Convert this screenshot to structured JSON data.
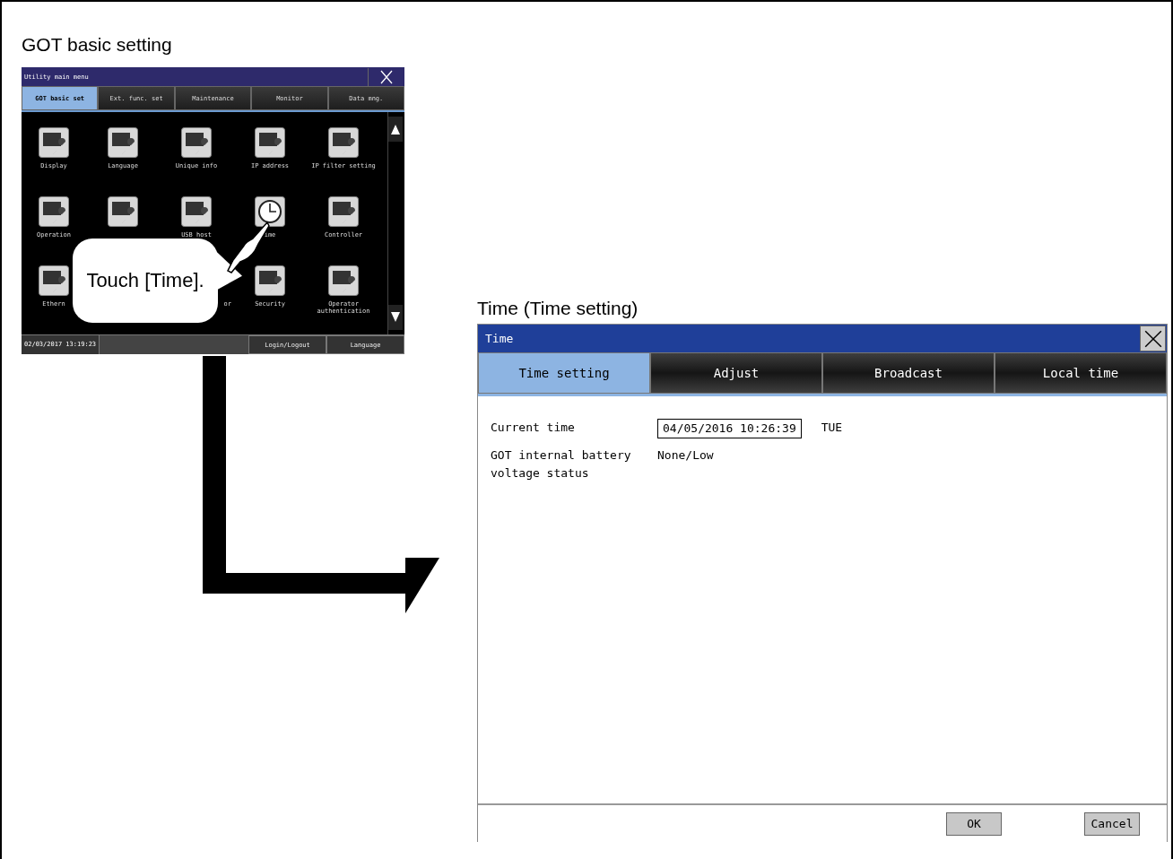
{
  "section_title": "GOT basic setting",
  "utility_menu": {
    "title": "Utility main menu",
    "tabs": [
      {
        "label": "GOT basic set",
        "selected": true
      },
      {
        "label": "Ext. func. set",
        "selected": false
      },
      {
        "label": "Maintenance",
        "selected": false
      },
      {
        "label": "Monitor",
        "selected": false
      },
      {
        "label": "Data mng.",
        "selected": false
      }
    ],
    "items": [
      {
        "kind": "tile",
        "label": "Display"
      },
      {
        "kind": "tile",
        "label": "Language"
      },
      {
        "kind": "tile",
        "label": "Unique info"
      },
      {
        "kind": "tile",
        "label": "IP address"
      },
      {
        "kind": "tile",
        "label": "IP filter setting"
      },
      {
        "kind": "tile",
        "label": "Operation"
      },
      {
        "kind": "tile"
      },
      {
        "kind": "tile",
        "label": "USB host"
      },
      {
        "kind": "clock",
        "label": "ime"
      },
      {
        "kind": "tile",
        "label": "Controller"
      },
      {
        "kind": "tile",
        "label": "Ethern"
      },
      {
        "kind": "covered"
      },
      {
        "kind": "covered",
        "label": "or"
      },
      {
        "kind": "tile",
        "label": "Security"
      },
      {
        "kind": "tile",
        "label": "Operator\nauthentication"
      }
    ],
    "callout": "Touch [Time].",
    "status_bar": {
      "datetime": "02/03/2017 13:19:23",
      "buttons": [
        "Login/Logout",
        "Language"
      ]
    }
  },
  "time_dialog_caption": "Time (Time setting)",
  "time_dialog": {
    "title": "Time",
    "tabs": [
      {
        "label": "Time setting",
        "selected": true
      },
      {
        "label": "Adjust",
        "selected": false
      },
      {
        "label": "Broadcast",
        "selected": false
      },
      {
        "label": "Local time",
        "selected": false
      }
    ],
    "fields": [
      {
        "label": "Current time",
        "value": "04/05/2016 10:26:39",
        "suffix": "TUE",
        "kind": "input"
      },
      {
        "label": "GOT internal battery voltage status",
        "value": "None/Low",
        "kind": "text"
      }
    ],
    "buttons": [
      "OK",
      "Cancel"
    ]
  }
}
